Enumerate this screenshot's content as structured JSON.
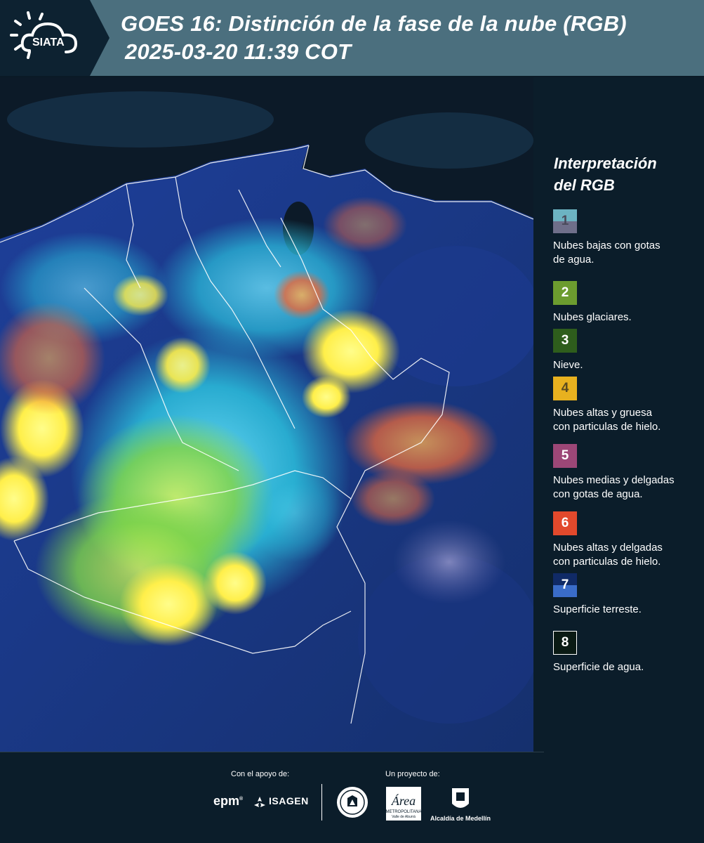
{
  "header": {
    "logo_text": "SIATA",
    "title_line1": "GOES 16: Distinción de la fase de la nube (RGB)",
    "title_line2": "2025-03-20 11:39 COT"
  },
  "map": {
    "icon": "satellite-map",
    "description_colors": {
      "ocean": "#0c1a2a",
      "land": "#1d3a8a",
      "high_thick_ice": "#fff25a",
      "glacial": "#9bd64a",
      "low_water": "#3fc8e0",
      "thin_ice": "#ff7a3c",
      "border": "#ffffff"
    }
  },
  "legend": {
    "title_line1": "Interpretación",
    "title_line2": "del RGB",
    "items": [
      {
        "number": "1",
        "label_line1": "Nubes bajas con gotas",
        "label_line2": "de agua.",
        "color_top": "#6cb3c2",
        "color_bottom": "#6f6f8a",
        "num_color": "#4a4a5a"
      },
      {
        "number": "2",
        "label_line1": "Nubes glaciares.",
        "label_line2": "",
        "color_top": "#6c9c2f",
        "color_bottom": "#6c9c2f",
        "num_color": "#ffffff"
      },
      {
        "number": "3",
        "label_line1": "Nieve.",
        "label_line2": "",
        "color_top": "#2e5d1c",
        "color_bottom": "#2e5d1c",
        "num_color": "#ffffff"
      },
      {
        "number": "4",
        "label_line1": "Nubes altas y gruesa",
        "label_line2": "con particulas de hielo.",
        "color_top": "#e8b11f",
        "color_bottom": "#e8b11f",
        "num_color": "#5a4a20"
      },
      {
        "number": "5",
        "label_line1": "Nubes medias y delgadas",
        "label_line2": "con gotas de agua.",
        "color_top": "#9c4777",
        "color_bottom": "#9c4777",
        "num_color": "#ffffff"
      },
      {
        "number": "6",
        "label_line1": "Nubes altas y delgadas",
        "label_line2": "con particulas de hielo.",
        "color_top": "#e2492c",
        "color_bottom": "#e2492c",
        "num_color": "#ffffff"
      },
      {
        "number": "7",
        "label_line1": "Superficie terreste.",
        "label_line2": "",
        "color_top": "#102a66",
        "color_bottom": "#3a6cc9",
        "num_color": "#ffffff"
      },
      {
        "number": "8",
        "label_line1": "Superficie de agua.",
        "label_line2": "",
        "color_top": "#0a1a14",
        "color_bottom": "#0a1a14",
        "num_color": "#ffffff"
      }
    ]
  },
  "footer": {
    "support_label": "Con el apoyo de:",
    "project_label": "Un proyecto de:",
    "epm": "epm",
    "isagen": "ISAGEN",
    "area_logo": "Área METROPOLITANA Valle de Aburrá",
    "alcaldia": "Alcaldía de Medellín"
  }
}
